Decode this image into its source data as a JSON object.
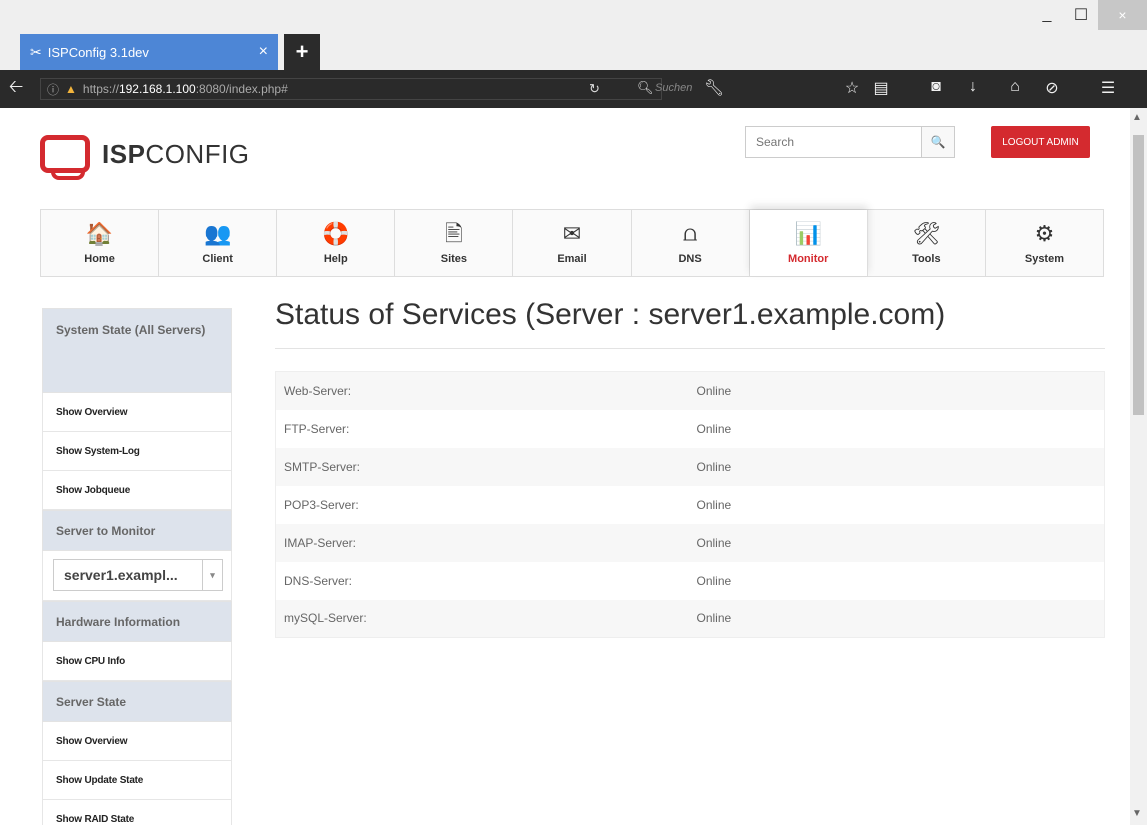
{
  "browser": {
    "tab_title": "ISPConfig 3.1dev",
    "tab_icon": "✂",
    "tab_close": "×",
    "newtab": "+",
    "win_min": "_",
    "win_max": "☐",
    "win_close": "×",
    "url_prefix": "https://",
    "url_host": "192.168.1.100",
    "url_rest": ":8080/index.php#",
    "search_placeholder": "Suchen",
    "toolbar_icons": [
      "wrench-icon",
      "star-icon",
      "reader-icon",
      "pocket-icon",
      "download-icon",
      "home-icon",
      "extension-icon",
      "menu-icon"
    ]
  },
  "header": {
    "logo_bold": "ISP",
    "logo_rest": "CONFIG",
    "search_placeholder": "Search",
    "search_button": "🔍",
    "logout_label": "LOGOUT ADMIN"
  },
  "nav": [
    {
      "label": "Home",
      "icon": "🏠"
    },
    {
      "label": "Client",
      "icon": "👥"
    },
    {
      "label": "Help",
      "icon": "🛟"
    },
    {
      "label": "Sites",
      "icon": "🖹"
    },
    {
      "label": "Email",
      "icon": "✉"
    },
    {
      "label": "DNS",
      "icon": "⩍"
    },
    {
      "label": "Monitor",
      "icon": "📊"
    },
    {
      "label": "Tools",
      "icon": "🛠"
    },
    {
      "label": "System",
      "icon": "⚙"
    }
  ],
  "sidebar": {
    "system_state_heading": "System State (All Servers)",
    "system_links": [
      "Show Overview",
      "Show System-Log",
      "Show Jobqueue"
    ],
    "server_heading": "Server to Monitor",
    "server_selected": "server1.exampl...",
    "hardware_heading": "Hardware Information",
    "hardware_links": [
      "Show CPU Info"
    ],
    "state_heading": "Server State",
    "state_links": [
      "Show Overview",
      "Show Update State",
      "Show RAID State"
    ]
  },
  "content": {
    "title": "Status of Services (Server : server1.example.com)",
    "services": [
      {
        "name": "Web-Server:",
        "status": "Online"
      },
      {
        "name": "FTP-Server:",
        "status": "Online"
      },
      {
        "name": "SMTP-Server:",
        "status": "Online"
      },
      {
        "name": "POP3-Server:",
        "status": "Online"
      },
      {
        "name": "IMAP-Server:",
        "status": "Online"
      },
      {
        "name": "DNS-Server:",
        "status": "Online"
      },
      {
        "name": "mySQL-Server:",
        "status": "Online"
      }
    ]
  },
  "colors": {
    "brand_red": "#d42a2f",
    "tab_blue": "#4d86d6",
    "sidebar_heading_bg": "#dde3ec"
  }
}
